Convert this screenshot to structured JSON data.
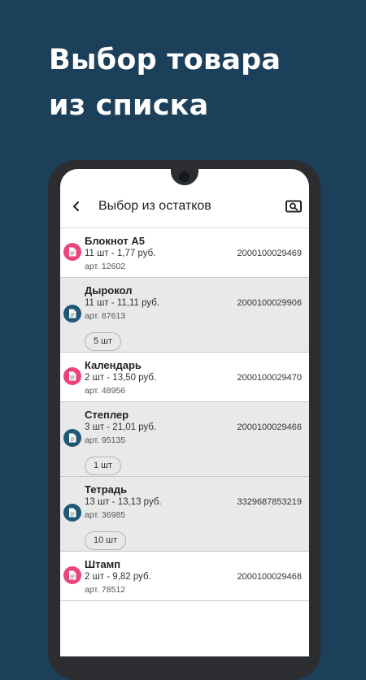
{
  "promo": {
    "line1": "Выбор товара",
    "line2": "из списка"
  },
  "appbar": {
    "back_icon": "arrow-back-icon",
    "title": "Выбор из остатков",
    "search_icon": "image-search-icon"
  },
  "colors": {
    "background": "#1c3f5a",
    "accent_pink": "#e7457c",
    "accent_blue": "#1f5876"
  },
  "items": [
    {
      "name": "Блокнот А5",
      "qty_price": "11 шт - 1,77 руб.",
      "article": "арт. 12602",
      "barcode": "2000100029469",
      "icon": "document-icon",
      "icon_color": "pink",
      "selected_qty": ""
    },
    {
      "name": "Дырокол",
      "qty_price": "11 шт - 11,11 руб.",
      "article": "арт. 87613",
      "barcode": "2000100029906",
      "icon": "document-icon",
      "icon_color": "blue",
      "selected_qty": "5 шт"
    },
    {
      "name": "Календарь",
      "qty_price": "2 шт - 13,50 руб.",
      "article": "арт. 48956",
      "barcode": "2000100029470",
      "icon": "document-icon",
      "icon_color": "pink",
      "selected_qty": ""
    },
    {
      "name": "Степлер",
      "qty_price": "3 шт - 21,01 руб.",
      "article": "арт. 95135",
      "barcode": "2000100029466",
      "icon": "document-icon",
      "icon_color": "blue",
      "selected_qty": "1 шт"
    },
    {
      "name": "Тетрадь",
      "qty_price": "13 шт - 13,13 руб.",
      "article": "арт. 36985",
      "barcode": "3329687853219",
      "icon": "document-icon",
      "icon_color": "blue",
      "selected_qty": "10 шт"
    },
    {
      "name": "Штамп",
      "qty_price": "2 шт - 9,82 руб.",
      "article": "арт. 78512",
      "barcode": "2000100029468",
      "icon": "document-icon",
      "icon_color": "pink",
      "selected_qty": ""
    }
  ]
}
